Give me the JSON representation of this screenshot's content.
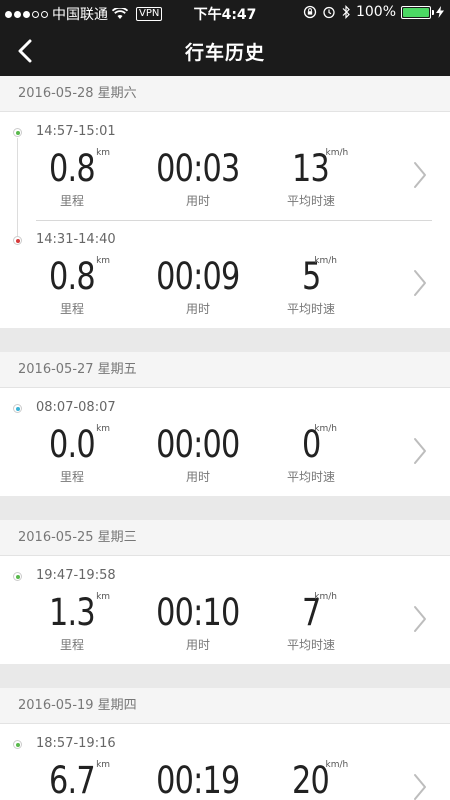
{
  "status_bar": {
    "carrier": "中国联通",
    "vpn": "VPN",
    "time": "下午4:47",
    "battery_percent": "100%",
    "battery_level": 1.0
  },
  "nav": {
    "title": "行车历史"
  },
  "labels": {
    "distance": "里程",
    "duration": "用时",
    "speed": "平均时速"
  },
  "units": {
    "distance": "km",
    "speed": "km/h"
  },
  "colors": {
    "green": "#5ab94d",
    "red": "#d63a3a",
    "cyan": "#3bb3d6"
  },
  "days": [
    {
      "date": "2016-05-28 星期六",
      "trips": [
        {
          "time": "14:57-15:01",
          "distance": "0.8",
          "duration": "00:03",
          "speed": "13",
          "dot": "green"
        },
        {
          "time": "14:31-14:40",
          "distance": "0.8",
          "duration": "00:09",
          "speed": "5",
          "dot": "red"
        }
      ]
    },
    {
      "date": "2016-05-27 星期五",
      "trips": [
        {
          "time": "08:07-08:07",
          "distance": "0.0",
          "duration": "00:00",
          "speed": "0",
          "dot": "cyan"
        }
      ]
    },
    {
      "date": "2016-05-25 星期三",
      "trips": [
        {
          "time": "19:47-19:58",
          "distance": "1.3",
          "duration": "00:10",
          "speed": "7",
          "dot": "green"
        }
      ]
    },
    {
      "date": "2016-05-19 星期四",
      "trips": [
        {
          "time": "18:57-19:16",
          "distance": "6.7",
          "duration": "00:19",
          "speed": "20",
          "dot": "green"
        }
      ]
    }
  ]
}
